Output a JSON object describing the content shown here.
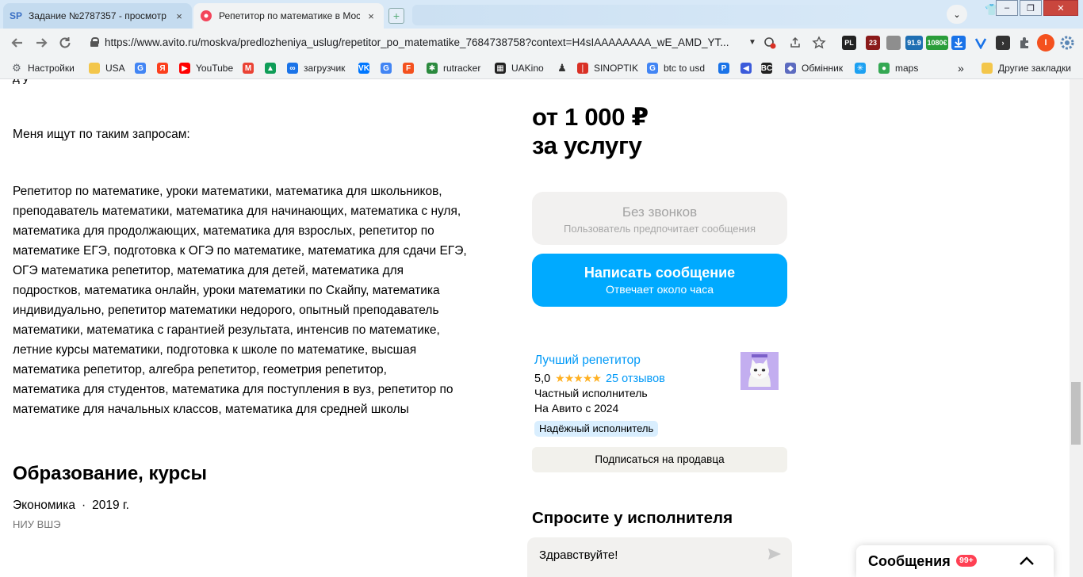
{
  "browser": {
    "tabs": [
      {
        "title": "Задание №2787357 - просмотр з",
        "favicon": "SP",
        "active": false
      },
      {
        "title": "Репетитор по математике в Моск",
        "favicon": "avito-dot",
        "active": true
      }
    ],
    "close_glyph": "×",
    "newtab_glyph": "+",
    "profile_glyph": "⌄",
    "window_controls": [
      "–",
      "❐",
      "✕"
    ],
    "url": "https://www.avito.ru/moskva/predlozheniya_uslug/repetitor_po_matematike_7684738758?context=H4sIAAAAAAAA_wE_AMD_YT...",
    "extensions": [
      {
        "label": "PL",
        "color": "#222222"
      },
      {
        "label": "23",
        "color": "#8b1a1a"
      },
      {
        "label": "91.9",
        "color": "#1f6fb3"
      },
      {
        "label": "1080€",
        "color": "#2a9d3a"
      }
    ],
    "profile_initial": "I"
  },
  "bookmarks": [
    {
      "label": "Настройки",
      "icon": "gear-icon",
      "color": "#5f6368"
    },
    {
      "label": "USA",
      "icon": "folder-icon",
      "color": "#f3c64b"
    },
    {
      "label": "",
      "icon": "google-icon",
      "color": "#4285f4"
    },
    {
      "label": "",
      "icon": "yandex-icon",
      "color": "#fc3f1d"
    },
    {
      "label": "YouTube",
      "icon": "youtube-icon",
      "color": "#ff0000"
    },
    {
      "label": "",
      "icon": "gmail-icon",
      "color": "#ea4335"
    },
    {
      "label": "",
      "icon": "drive-icon",
      "color": "#0f9d58"
    },
    {
      "label": "загрузчик",
      "icon": "infinity-icon",
      "color": "#1a73e8"
    },
    {
      "label": "",
      "icon": "vk-icon",
      "color": "#0077ff"
    },
    {
      "label": "",
      "icon": "translate-icon",
      "color": "#4285f4"
    },
    {
      "label": "",
      "icon": "f-icon",
      "color": "#f4511e"
    },
    {
      "label": "rutracker",
      "icon": "rutracker-icon",
      "color": "#2b8a3e"
    },
    {
      "label": "UAKino",
      "icon": "uakino-icon",
      "color": "#222222"
    },
    {
      "label": "",
      "icon": "person-icon",
      "color": "#333333"
    },
    {
      "label": "SINOPTIK",
      "icon": "thermometer-icon",
      "color": "#d93025"
    },
    {
      "label": "btc to usd",
      "icon": "google-icon",
      "color": "#4285f4"
    },
    {
      "label": "",
      "icon": "p-icon",
      "color": "#1a73e8"
    },
    {
      "label": "",
      "icon": "arrow-icon",
      "color": "#3b5bdb"
    },
    {
      "label": "",
      "icon": "bc-icon",
      "color": "#222222"
    },
    {
      "label": "Обмінник",
      "icon": "diamond-icon",
      "color": "#5c6bc0"
    },
    {
      "label": "",
      "icon": "snowflake-icon",
      "color": "#1da1f2"
    },
    {
      "label": "maps",
      "icon": "maps-pin-icon",
      "color": "#34a853"
    },
    {
      "label": "Другие закладки",
      "icon": "folder-icon",
      "color": "#f3c64b"
    }
  ],
  "bookmarks_more": "»",
  "content": {
    "cut_text": "д у",
    "queries_label": "Меня ищут по таким запросам:",
    "queries_lines": [
      "Репетитор по математике, уроки математики, математика для школьников,",
      "преподаватель математики, математика для начинающих, математика с нуля,",
      "математика для продолжающих, математика для взрослых, репетитор по",
      "математике ЕГЭ, подготовка к ОГЭ по математике, математика для сдачи ЕГЭ,",
      "ОГЭ математика репетитор, математика для детей, математика для",
      "подростков, математика онлайн, уроки математики по Скайпу, математика",
      "индивидуально, репетитор математики недорого, опытный преподаватель",
      "математики, математика с гарантией результата, интенсив по математике,",
      "летние курсы математики, подготовка к школе по математике, высшая",
      "математика репетитор, алгебра репетитор, геометрия репетитор,",
      "математика для студентов, математика для поступления в вуз, репетитор по",
      "математике для начальных классов, математика для средней школы"
    ],
    "education": {
      "title": "Образование, курсы",
      "field": "Экономика",
      "separator": "·",
      "year": "2019 г.",
      "school": "НИУ ВШЭ"
    }
  },
  "sidebar": {
    "price_line1": "от 1 000 ₽",
    "price_line2": "за услугу",
    "no_calls_title": "Без звонков",
    "no_calls_sub": "Пользователь предпочитает сообщения",
    "write_title": "Написать сообщение",
    "write_sub": "Отвечает около часа",
    "seller_name": "Лучший репетитор",
    "rating": "5,0",
    "stars": 5,
    "reviews": "25 отзывов",
    "seller_type": "Частный исполнитель",
    "seller_since": "На Авито с 2024",
    "badge": "Надёжный исполнитель",
    "subscribe": "Подписаться на продавца",
    "ask_title": "Спросите у исполнителя",
    "ask_value": "Здравствуйте!"
  },
  "messenger": {
    "title": "Сообщения",
    "count": "99+"
  },
  "colors": {
    "avito_blue": "#00aaff",
    "link_blue": "#0099f7",
    "star": "#ffb021",
    "badge_red": "#ff4053"
  }
}
